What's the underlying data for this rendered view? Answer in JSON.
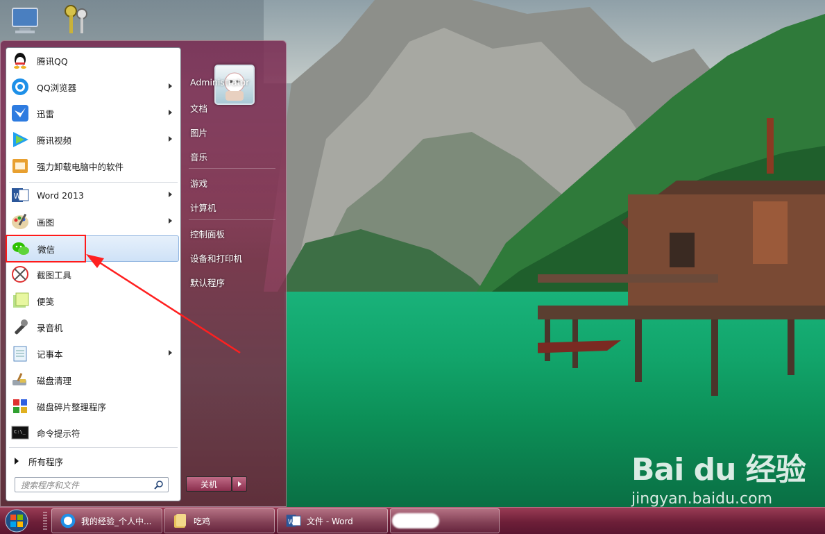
{
  "start_menu": {
    "pinned": [
      {
        "label": "腾讯QQ",
        "icon": "qq-icon",
        "submenu": false
      },
      {
        "label": "QQ浏览器",
        "icon": "qq-browser-icon",
        "submenu": true
      },
      {
        "label": "迅雷",
        "icon": "xunlei-icon",
        "submenu": true
      },
      {
        "label": "腾讯视频",
        "icon": "tencent-video-icon",
        "submenu": true
      },
      {
        "label": "强力卸载电脑中的软件",
        "icon": "uninstaller-icon",
        "submenu": false
      }
    ],
    "recent": [
      {
        "label": "Word 2013",
        "icon": "word-icon",
        "submenu": true
      },
      {
        "label": "画图",
        "icon": "paint-icon",
        "submenu": true
      },
      {
        "label": "微信",
        "icon": "wechat-icon",
        "submenu": false,
        "highlighted": true
      },
      {
        "label": "截图工具",
        "icon": "snipping-tool-icon",
        "submenu": false
      },
      {
        "label": "便笺",
        "icon": "sticky-notes-icon",
        "submenu": false
      },
      {
        "label": "录音机",
        "icon": "sound-recorder-icon",
        "submenu": false
      },
      {
        "label": "记事本",
        "icon": "notepad-icon",
        "submenu": true
      },
      {
        "label": "磁盘清理",
        "icon": "disk-cleanup-icon",
        "submenu": false
      },
      {
        "label": "磁盘碎片整理程序",
        "icon": "defragmenter-icon",
        "submenu": false
      },
      {
        "label": "命令提示符",
        "icon": "cmd-icon",
        "submenu": false
      }
    ],
    "all_programs": "所有程序",
    "search_placeholder": "搜索程序和文件",
    "right_items": [
      "Administrator",
      "文档",
      "图片",
      "音乐",
      "游戏",
      "计算机",
      "控制面板",
      "设备和打印机",
      "默认程序"
    ],
    "shutdown_label": "关机"
  },
  "taskbar": {
    "buttons": [
      {
        "label": "我的经验_个人中...",
        "icon": "qq-browser-icon"
      },
      {
        "label": "吃鸡",
        "icon": "folder-icon"
      },
      {
        "label": "文件 - Word",
        "icon": "word-icon"
      }
    ]
  },
  "watermark": {
    "brand": "Bai du 经验",
    "url": "jingyan.baidu.com"
  },
  "colors": {
    "highlight_border": "#ff1a1a",
    "accent": "#8a2e4d"
  }
}
